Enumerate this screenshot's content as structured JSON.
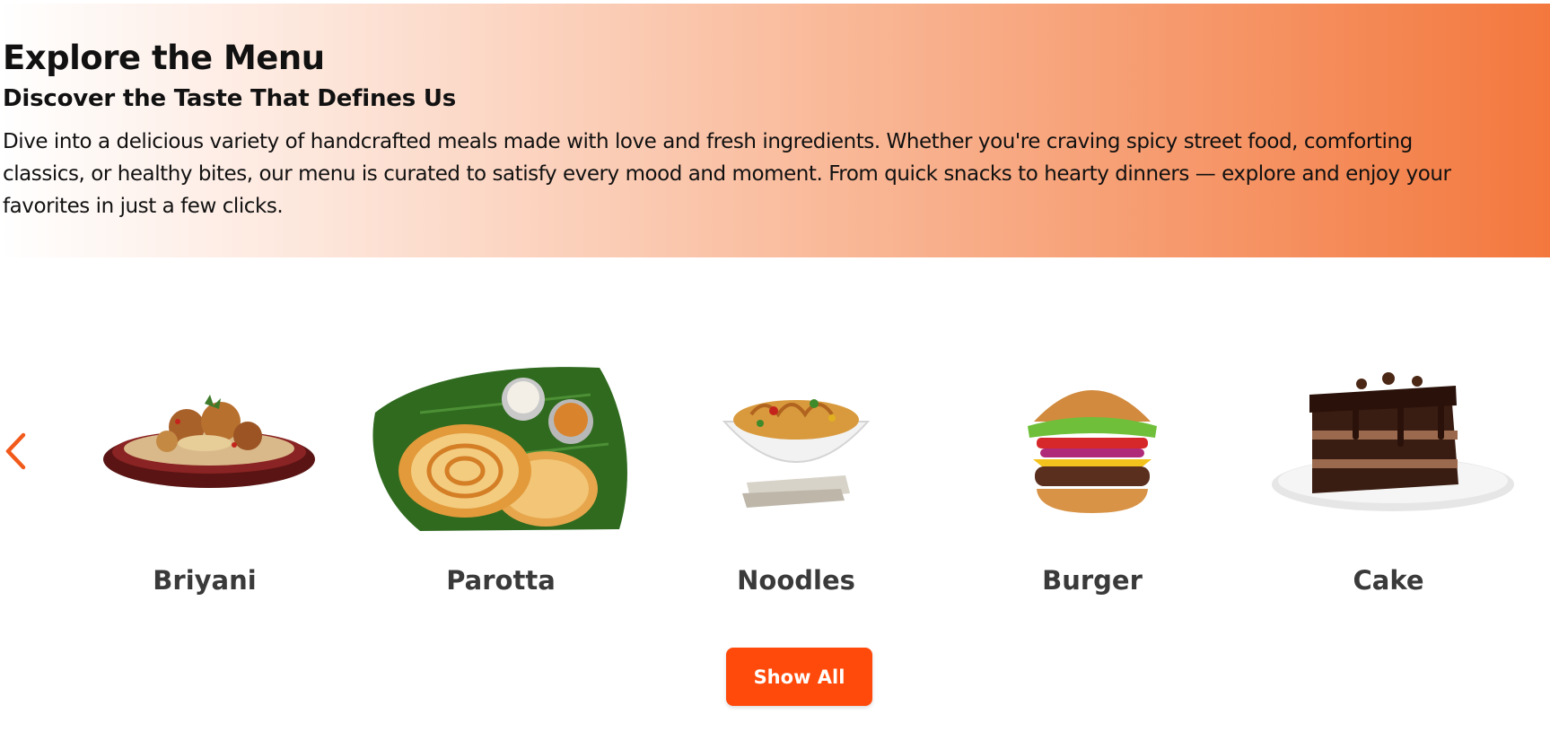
{
  "hero": {
    "title": "Explore the Menu",
    "subtitle": "Discover the Taste That Defines Us",
    "description": "Dive into a delicious variety of handcrafted meals made with love and fresh ingredients. Whether you're craving spicy street food, comforting\nclassics, or healthy bites, our menu is curated to satisfy every mood and moment. From quick snacks to hearty dinners — explore and enjoy your\nfavorites in just a few clicks."
  },
  "carousel": {
    "prev_icon": "chevron-left-icon",
    "items": [
      {
        "label": "Briyani",
        "icon": "biryani-image"
      },
      {
        "label": "Parotta",
        "icon": "parotta-image"
      },
      {
        "label": "Noodles",
        "icon": "noodles-image"
      },
      {
        "label": "Burger",
        "icon": "burger-image"
      },
      {
        "label": "Cake",
        "icon": "cake-image"
      }
    ]
  },
  "actions": {
    "show_all_label": "Show All"
  },
  "colors": {
    "accent": "#ff4a0b",
    "arrow": "#f25a1c",
    "hero_end": "#f3783e"
  }
}
